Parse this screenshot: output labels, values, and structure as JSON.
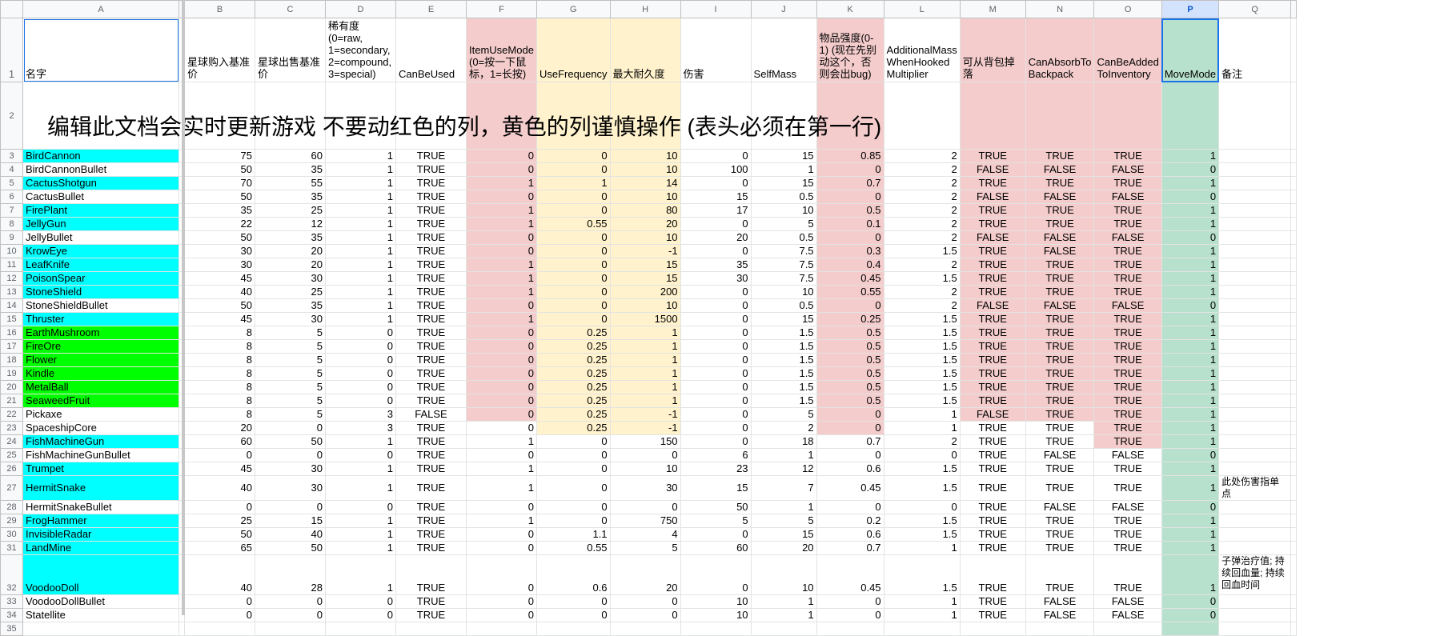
{
  "columns": [
    "A",
    "B",
    "C",
    "D",
    "E",
    "F",
    "G",
    "H",
    "I",
    "J",
    "K",
    "L",
    "M",
    "N",
    "O",
    "P",
    "Q",
    ""
  ],
  "selected_column": "P",
  "header_row": {
    "A": "名字",
    "B": "星球购入基准价",
    "C": "星球出售基准价",
    "D": "稀有度(0=raw, 1=secondary, 2=compound, 3=special)",
    "E": "CanBeUsed",
    "F": "ItemUseMode (0=按一下鼠标，1=长按)",
    "G": "UseFrequency",
    "H": "最大耐久度",
    "I": "伤害",
    "J": "SelfMass",
    "K": "物品强度(0-1) (现在先别动这个，否则会出bug)",
    "L": "AdditionalMass WhenHooked Multiplier",
    "M": "可从背包掉落",
    "N": "CanAbsorbTo Backpack",
    "O": "CanBeAdded ToInventory",
    "P": "MoveMode",
    "Q": "备注"
  },
  "note_row": "编辑此文档会实时更新游戏   不要动红色的列，黄色的列谨慎操作 (表头必须在第一行)",
  "rows": [
    {
      "n": "3",
      "name": "BirdCannon",
      "b": "75",
      "c": "60",
      "d": "1",
      "e": "TRUE",
      "f": "0",
      "g": "0",
      "h": "10",
      "i": "0",
      "j": "15",
      "k": "0.85",
      "l": "2",
      "m": "TRUE",
      "nn": "TRUE",
      "o": "TRUE",
      "p": "1",
      "q": ""
    },
    {
      "n": "4",
      "name": "BirdCannonBullet",
      "b": "50",
      "c": "35",
      "d": "1",
      "e": "TRUE",
      "f": "0",
      "g": "0",
      "h": "10",
      "i": "100",
      "j": "1",
      "k": "0",
      "l": "2",
      "m": "FALSE",
      "nn": "FALSE",
      "o": "FALSE",
      "p": "0",
      "q": ""
    },
    {
      "n": "5",
      "name": "CactusShotgun",
      "b": "70",
      "c": "55",
      "d": "1",
      "e": "TRUE",
      "f": "1",
      "g": "1",
      "h": "14",
      "i": "0",
      "j": "15",
      "k": "0.7",
      "l": "2",
      "m": "TRUE",
      "nn": "TRUE",
      "o": "TRUE",
      "p": "1",
      "q": ""
    },
    {
      "n": "6",
      "name": "CactusBullet",
      "b": "50",
      "c": "35",
      "d": "1",
      "e": "TRUE",
      "f": "0",
      "g": "0",
      "h": "10",
      "i": "15",
      "j": "0.5",
      "k": "0",
      "l": "2",
      "m": "FALSE",
      "nn": "FALSE",
      "o": "FALSE",
      "p": "0",
      "q": ""
    },
    {
      "n": "7",
      "name": "FirePlant",
      "b": "35",
      "c": "25",
      "d": "1",
      "e": "TRUE",
      "f": "1",
      "g": "0",
      "h": "80",
      "i": "17",
      "j": "10",
      "k": "0.5",
      "l": "2",
      "m": "TRUE",
      "nn": "TRUE",
      "o": "TRUE",
      "p": "1",
      "q": ""
    },
    {
      "n": "8",
      "name": "JellyGun",
      "b": "22",
      "c": "12",
      "d": "1",
      "e": "TRUE",
      "f": "1",
      "g": "0.55",
      "h": "20",
      "i": "0",
      "j": "5",
      "k": "0.1",
      "l": "2",
      "m": "TRUE",
      "nn": "TRUE",
      "o": "TRUE",
      "p": "1",
      "q": ""
    },
    {
      "n": "9",
      "name": "JellyBullet",
      "b": "50",
      "c": "35",
      "d": "1",
      "e": "TRUE",
      "f": "0",
      "g": "0",
      "h": "10",
      "i": "20",
      "j": "0.5",
      "k": "0",
      "l": "2",
      "m": "FALSE",
      "nn": "FALSE",
      "o": "FALSE",
      "p": "0",
      "q": ""
    },
    {
      "n": "10",
      "name": "KrowEye",
      "b": "30",
      "c": "20",
      "d": "1",
      "e": "TRUE",
      "f": "0",
      "g": "0",
      "h": "-1",
      "i": "0",
      "j": "7.5",
      "k": "0.3",
      "l": "1.5",
      "m": "TRUE",
      "nn": "FALSE",
      "o": "TRUE",
      "p": "1",
      "q": ""
    },
    {
      "n": "11",
      "name": "LeafKnife",
      "b": "30",
      "c": "20",
      "d": "1",
      "e": "TRUE",
      "f": "1",
      "g": "0",
      "h": "15",
      "i": "35",
      "j": "7.5",
      "k": "0.4",
      "l": "2",
      "m": "TRUE",
      "nn": "TRUE",
      "o": "TRUE",
      "p": "1",
      "q": ""
    },
    {
      "n": "12",
      "name": "PoisonSpear",
      "b": "45",
      "c": "30",
      "d": "1",
      "e": "TRUE",
      "f": "1",
      "g": "0",
      "h": "15",
      "i": "30",
      "j": "7.5",
      "k": "0.45",
      "l": "1.5",
      "m": "TRUE",
      "nn": "TRUE",
      "o": "TRUE",
      "p": "1",
      "q": ""
    },
    {
      "n": "13",
      "name": "StoneShield",
      "b": "40",
      "c": "25",
      "d": "1",
      "e": "TRUE",
      "f": "1",
      "g": "0",
      "h": "200",
      "i": "0",
      "j": "10",
      "k": "0.55",
      "l": "2",
      "m": "TRUE",
      "nn": "TRUE",
      "o": "TRUE",
      "p": "1",
      "q": ""
    },
    {
      "n": "14",
      "name": "StoneShieldBullet",
      "b": "50",
      "c": "35",
      "d": "1",
      "e": "TRUE",
      "f": "0",
      "g": "0",
      "h": "10",
      "i": "0",
      "j": "0.5",
      "k": "0",
      "l": "2",
      "m": "FALSE",
      "nn": "FALSE",
      "o": "FALSE",
      "p": "0",
      "q": ""
    },
    {
      "n": "15",
      "name": "Thruster",
      "b": "45",
      "c": "30",
      "d": "1",
      "e": "TRUE",
      "f": "1",
      "g": "0",
      "h": "1500",
      "i": "0",
      "j": "15",
      "k": "0.25",
      "l": "1.5",
      "m": "TRUE",
      "nn": "TRUE",
      "o": "TRUE",
      "p": "1",
      "q": ""
    },
    {
      "n": "16",
      "name": "EarthMushroom",
      "b": "8",
      "c": "5",
      "d": "0",
      "e": "TRUE",
      "f": "0",
      "g": "0.25",
      "h": "1",
      "i": "0",
      "j": "1.5",
      "k": "0.5",
      "l": "1.5",
      "m": "TRUE",
      "nn": "TRUE",
      "o": "TRUE",
      "p": "1",
      "q": ""
    },
    {
      "n": "17",
      "name": "FireOre",
      "b": "8",
      "c": "5",
      "d": "0",
      "e": "TRUE",
      "f": "0",
      "g": "0.25",
      "h": "1",
      "i": "0",
      "j": "1.5",
      "k": "0.5",
      "l": "1.5",
      "m": "TRUE",
      "nn": "TRUE",
      "o": "TRUE",
      "p": "1",
      "q": ""
    },
    {
      "n": "18",
      "name": "Flower",
      "b": "8",
      "c": "5",
      "d": "0",
      "e": "TRUE",
      "f": "0",
      "g": "0.25",
      "h": "1",
      "i": "0",
      "j": "1.5",
      "k": "0.5",
      "l": "1.5",
      "m": "TRUE",
      "nn": "TRUE",
      "o": "TRUE",
      "p": "1",
      "q": ""
    },
    {
      "n": "19",
      "name": "Kindle",
      "b": "8",
      "c": "5",
      "d": "0",
      "e": "TRUE",
      "f": "0",
      "g": "0.25",
      "h": "1",
      "i": "0",
      "j": "1.5",
      "k": "0.5",
      "l": "1.5",
      "m": "TRUE",
      "nn": "TRUE",
      "o": "TRUE",
      "p": "1",
      "q": ""
    },
    {
      "n": "20",
      "name": "MetalBall",
      "b": "8",
      "c": "5",
      "d": "0",
      "e": "TRUE",
      "f": "0",
      "g": "0.25",
      "h": "1",
      "i": "0",
      "j": "1.5",
      "k": "0.5",
      "l": "1.5",
      "m": "TRUE",
      "nn": "TRUE",
      "o": "TRUE",
      "p": "1",
      "q": ""
    },
    {
      "n": "21",
      "name": "SeaweedFruit",
      "b": "8",
      "c": "5",
      "d": "0",
      "e": "TRUE",
      "f": "0",
      "g": "0.25",
      "h": "1",
      "i": "0",
      "j": "1.5",
      "k": "0.5",
      "l": "1.5",
      "m": "TRUE",
      "nn": "TRUE",
      "o": "TRUE",
      "p": "1",
      "q": ""
    },
    {
      "n": "22",
      "name": "Pickaxe",
      "b": "8",
      "c": "5",
      "d": "3",
      "e": "FALSE",
      "f": "0",
      "g": "0.25",
      "h": "-1",
      "i": "0",
      "j": "5",
      "k": "0",
      "l": "1",
      "m": "FALSE",
      "nn": "TRUE",
      "o": "TRUE",
      "p": "1",
      "q": ""
    },
    {
      "n": "23",
      "name": "SpaceshipCore",
      "b": "20",
      "c": "0",
      "d": "3",
      "e": "TRUE",
      "f": "0",
      "g": "0.25",
      "h": "-1",
      "i": "0",
      "j": "2",
      "k": "0",
      "l": "1",
      "m": "TRUE",
      "nn": "TRUE",
      "o": "TRUE",
      "p": "1",
      "q": ""
    },
    {
      "n": "24",
      "name": "FishMachineGun",
      "b": "60",
      "c": "50",
      "d": "1",
      "e": "TRUE",
      "f": "1",
      "g": "0",
      "h": "150",
      "i": "0",
      "j": "18",
      "k": "0.7",
      "l": "2",
      "m": "TRUE",
      "nn": "TRUE",
      "o": "TRUE",
      "p": "1",
      "q": ""
    },
    {
      "n": "25",
      "name": "FishMachineGunBullet",
      "b": "0",
      "c": "0",
      "d": "0",
      "e": "TRUE",
      "f": "0",
      "g": "0",
      "h": "0",
      "i": "6",
      "j": "1",
      "k": "0",
      "l": "0",
      "m": "TRUE",
      "nn": "FALSE",
      "o": "FALSE",
      "p": "0",
      "q": ""
    },
    {
      "n": "26",
      "name": "Trumpet",
      "b": "45",
      "c": "30",
      "d": "1",
      "e": "TRUE",
      "f": "1",
      "g": "0",
      "h": "10",
      "i": "23",
      "j": "12",
      "k": "0.6",
      "l": "1.5",
      "m": "TRUE",
      "nn": "TRUE",
      "o": "TRUE",
      "p": "1",
      "q": ""
    },
    {
      "n": "27",
      "name": "HermitSnake",
      "b": "40",
      "c": "30",
      "d": "1",
      "e": "TRUE",
      "f": "1",
      "g": "0",
      "h": "30",
      "i": "15",
      "j": "7",
      "k": "0.45",
      "l": "1.5",
      "m": "TRUE",
      "nn": "TRUE",
      "o": "TRUE",
      "p": "1",
      "q": "此处伤害指单点"
    },
    {
      "n": "28",
      "name": "HermitSnakeBullet",
      "b": "0",
      "c": "0",
      "d": "0",
      "e": "TRUE",
      "f": "0",
      "g": "0",
      "h": "0",
      "i": "50",
      "j": "1",
      "k": "0",
      "l": "0",
      "m": "TRUE",
      "nn": "FALSE",
      "o": "FALSE",
      "p": "0",
      "q": ""
    },
    {
      "n": "29",
      "name": "FrogHammer",
      "b": "25",
      "c": "15",
      "d": "1",
      "e": "TRUE",
      "f": "1",
      "g": "0",
      "h": "750",
      "i": "5",
      "j": "5",
      "k": "0.2",
      "l": "1.5",
      "m": "TRUE",
      "nn": "TRUE",
      "o": "TRUE",
      "p": "1",
      "q": ""
    },
    {
      "n": "30",
      "name": "InvisibleRadar",
      "b": "50",
      "c": "40",
      "d": "1",
      "e": "TRUE",
      "f": "0",
      "g": "1.1",
      "h": "4",
      "i": "0",
      "j": "15",
      "k": "0.6",
      "l": "1.5",
      "m": "TRUE",
      "nn": "TRUE",
      "o": "TRUE",
      "p": "1",
      "q": ""
    },
    {
      "n": "31",
      "name": "LandMine",
      "b": "65",
      "c": "50",
      "d": "1",
      "e": "TRUE",
      "f": "0",
      "g": "0.55",
      "h": "5",
      "i": "60",
      "j": "20",
      "k": "0.7",
      "l": "1",
      "m": "TRUE",
      "nn": "TRUE",
      "o": "TRUE",
      "p": "1",
      "q": ""
    },
    {
      "n": "32",
      "name": "VoodooDoll",
      "b": "40",
      "c": "28",
      "d": "1",
      "e": "TRUE",
      "f": "0",
      "g": "0.6",
      "h": "20",
      "i": "0",
      "j": "10",
      "k": "0.45",
      "l": "1.5",
      "m": "TRUE",
      "nn": "TRUE",
      "o": "TRUE",
      "p": "1",
      "q": "子弹治疗值; 持续回血量; 持续回血时间"
    },
    {
      "n": "33",
      "name": "VoodooDollBullet",
      "b": "0",
      "c": "0",
      "d": "0",
      "e": "TRUE",
      "f": "0",
      "g": "0",
      "h": "0",
      "i": "10",
      "j": "1",
      "k": "0",
      "l": "1",
      "m": "TRUE",
      "nn": "FALSE",
      "o": "FALSE",
      "p": "0",
      "q": ""
    },
    {
      "n": "34",
      "name": "Statellite",
      "b": "0",
      "c": "0",
      "d": "0",
      "e": "TRUE",
      "f": "0",
      "g": "0",
      "h": "0",
      "i": "10",
      "j": "1",
      "k": "0",
      "l": "1",
      "m": "TRUE",
      "nn": "FALSE",
      "o": "FALSE",
      "p": "0",
      "q": ""
    },
    {
      "n": "35",
      "name": "",
      "b": "",
      "c": "",
      "d": "",
      "e": "",
      "f": "",
      "g": "",
      "h": "",
      "i": "",
      "j": "",
      "k": "",
      "l": "",
      "m": "",
      "nn": "",
      "o": "",
      "p": "",
      "q": ""
    }
  ],
  "name_colors": {
    "BirdCannon": "cyan",
    "CactusShotgun": "cyan",
    "FirePlant": "cyan",
    "JellyGun": "cyan",
    "KrowEye": "cyan",
    "LeafKnife": "cyan",
    "PoisonSpear": "cyan",
    "StoneShield": "cyan",
    "Thruster": "cyan",
    "EarthMushroom": "lime",
    "FireOre": "lime",
    "Flower": "lime",
    "Kindle": "lime",
    "MetalBall": "lime",
    "SeaweedFruit": "lime",
    "FishMachineGun": "cyan",
    "Trumpet": "cyan",
    "HermitSnake": "cyan",
    "FrogHammer": "cyan",
    "InvisibleRadar": "cyan",
    "LandMine": "cyan",
    "VoodooDoll": "cyan"
  },
  "colors": {
    "red_column": "#f4cccc",
    "yellow_column": "#fff2cc",
    "green_column": "#b7e1cd",
    "cyan": "#00ffff",
    "lime": "#00ff00",
    "selection": "#1a73e8"
  }
}
